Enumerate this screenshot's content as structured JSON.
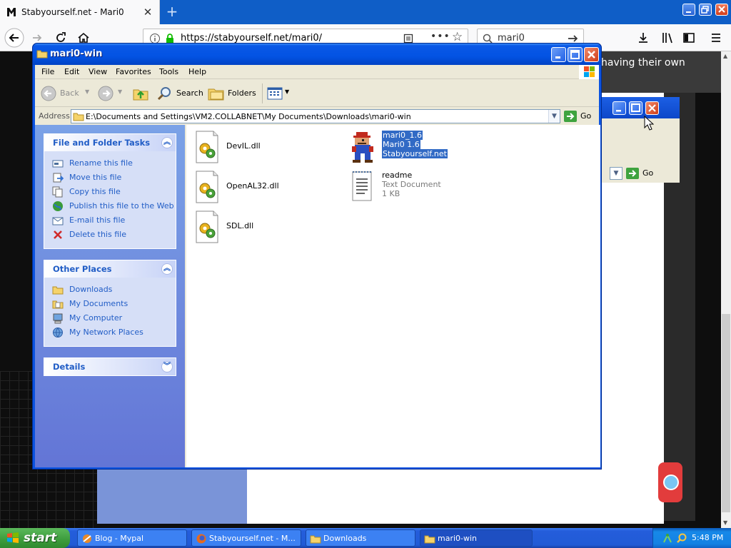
{
  "firefox": {
    "tab_title": "Stabyourself.net - Mari0",
    "url": "https://stabyourself.net/mari0/",
    "search_value": "mari0",
    "page_text_fragment": "having their own"
  },
  "explorer": {
    "title": "mari0-win",
    "menu": [
      "File",
      "Edit",
      "View",
      "Favorites",
      "Tools",
      "Help"
    ],
    "toolbar": {
      "back": "Back",
      "search": "Search",
      "folders": "Folders"
    },
    "address": {
      "label": "Address",
      "path": "E:\\Documents and Settings\\VM2.COLLABNET\\My Documents\\Downloads\\mari0-win",
      "go": "Go"
    },
    "file_tasks": {
      "title": "File and Folder Tasks",
      "items": [
        "Rename this file",
        "Move this file",
        "Copy this file",
        "Publish this file to the Web",
        "E-mail this file",
        "Delete this file"
      ]
    },
    "other_places": {
      "title": "Other Places",
      "items": [
        "Downloads",
        "My Documents",
        "My Computer",
        "My Network Places"
      ]
    },
    "details": {
      "title": "Details"
    },
    "files": [
      {
        "name": "DevIL.dll",
        "icon": "dll-icon"
      },
      {
        "name": "OpenAL32.dll",
        "icon": "dll-icon"
      },
      {
        "name": "SDL.dll",
        "icon": "dll-icon"
      },
      {
        "name": "mari0_1.6",
        "line2": "Mari0 1.6",
        "line3": "Stabyourself.net",
        "icon": "mario-icon",
        "selected": true
      },
      {
        "name": "readme",
        "line2": "Text Document",
        "line3": "1 KB",
        "icon": "text-document-icon"
      }
    ]
  },
  "background_window": {
    "go": "Go"
  },
  "taskbar": {
    "start": "start",
    "tasks": [
      "Blog - Mypal",
      "Stabyourself.net - M...",
      "Downloads",
      "mari0-win"
    ],
    "active_task": "mari0-win",
    "clock": "5:48 PM"
  },
  "colors": {
    "xp_blue": "#0053e3",
    "selection": "#316ac5",
    "task_link": "#215dc6",
    "start_green": "#3c9b3c"
  }
}
